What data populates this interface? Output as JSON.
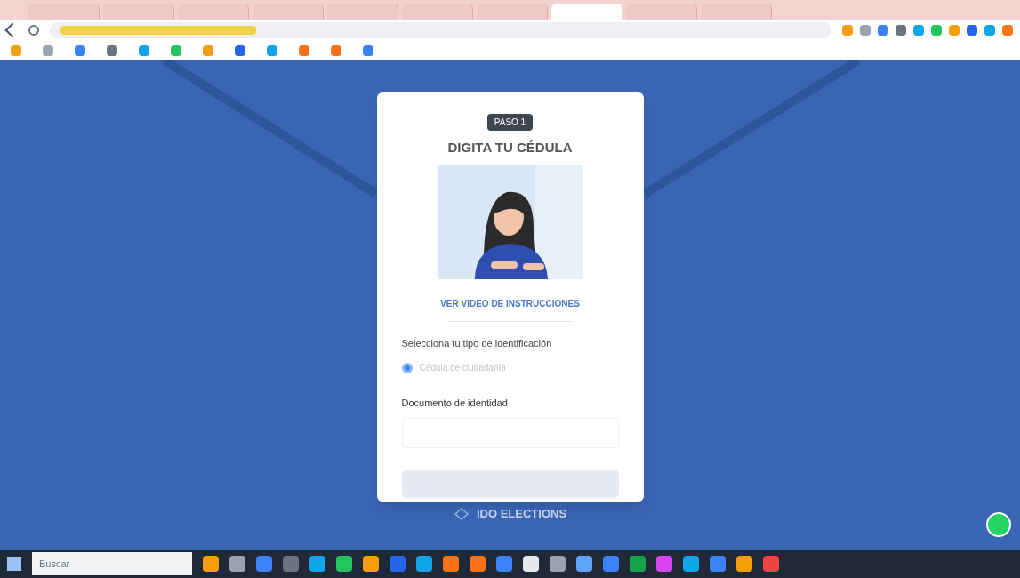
{
  "browser": {
    "tabs": [
      {
        "selected": false
      },
      {
        "selected": false
      },
      {
        "selected": false
      },
      {
        "selected": false
      },
      {
        "selected": false
      },
      {
        "selected": false
      },
      {
        "selected": false
      },
      {
        "selected": true
      },
      {
        "selected": false
      },
      {
        "selected": false
      }
    ]
  },
  "card": {
    "step": "PASO 1",
    "title": "DIGITA TU CÉDULA",
    "video_link": "VER VIDEO DE INSTRUCCIONES",
    "id_type_label": "Selecciona tu tipo de identificación",
    "options": [
      {
        "label": "Cédula de ciudadanía",
        "selected": true
      }
    ],
    "document_label": "Documento de identidad",
    "submit_disabled": true
  },
  "footer_logo": "IDO ELECTIONS",
  "taskbar": {
    "search_placeholder": "Buscar"
  }
}
